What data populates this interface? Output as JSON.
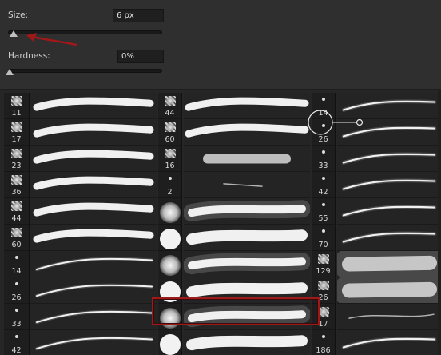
{
  "size": {
    "label": "Size:",
    "value": "6 px",
    "level": 0.03
  },
  "hardness": {
    "label": "Hardness:",
    "value": "0%",
    "level": 0
  },
  "colors": {
    "accent": "#9c1a1a",
    "panel": "#2f2f2f",
    "text": "#d8d8d8"
  },
  "brushes": {
    "column_1": [
      "11",
      "17",
      "23",
      "36",
      "44",
      "60",
      "14",
      "26",
      "33",
      "42"
    ],
    "column_2": [
      "44",
      "60",
      "16",
      "2",
      "",
      "",
      "",
      "",
      "",
      ""
    ],
    "column_3": [
      "14",
      "26",
      "33",
      "42",
      "55",
      "70",
      "129",
      "26",
      "17",
      "186"
    ],
    "selected": "column_2 row 9"
  },
  "icons": {
    "arrow": "red-arrow-icon",
    "hover": "brush-cursor-circle-icon"
  }
}
